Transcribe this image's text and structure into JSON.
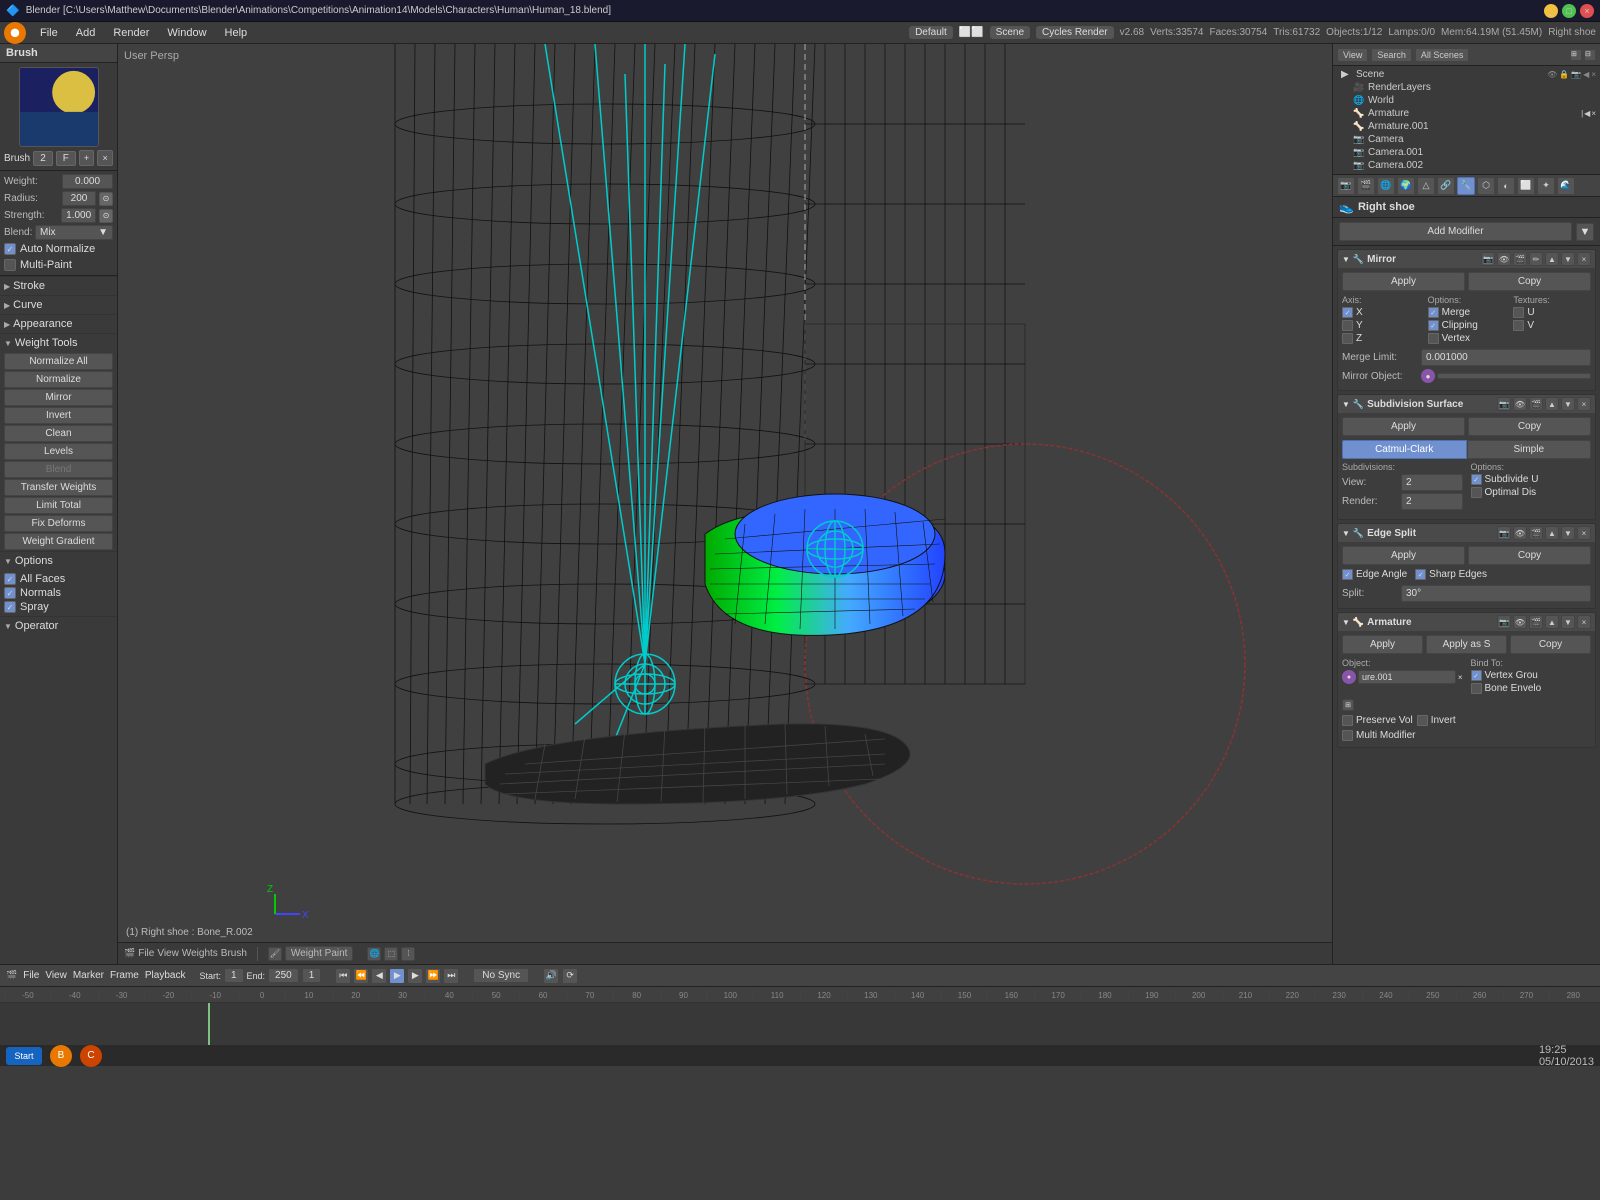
{
  "titlebar": {
    "title": "Blender  [C:\\Users\\Matthew\\Documents\\Blender\\Animations\\Competitions\\Animation14\\Models\\Characters\\Human\\Human_18.blend]"
  },
  "menubar": {
    "logo": "B",
    "items": [
      "File",
      "Add",
      "Render",
      "Window",
      "Help"
    ]
  },
  "infobar": {
    "layout": "Default",
    "scene": "Scene",
    "render": "Cycles Render",
    "version": "v2.68",
    "verts": "Verts:33574",
    "faces": "Faces:30754",
    "tris": "Tris:61732",
    "objects": "Objects:1/12",
    "lamps": "Lamps:0/0",
    "mem": "Mem:64.19M (51.45M)",
    "info": "Right shoe"
  },
  "left_panel": {
    "header": "Brush",
    "brush_num": "2",
    "brush_flag": "F",
    "weight": "0.000",
    "radius": "200",
    "strength": "1.000",
    "blend": "Mix",
    "auto_normalize": "Auto Normalize",
    "multi_paint": "Multi-Paint",
    "stroke_label": "Stroke",
    "curve_label": "Curve",
    "appearance_label": "Appearance",
    "weight_tools_label": "Weight Tools",
    "buttons": [
      "Normalize All",
      "Normalize",
      "Mirror",
      "Invert",
      "Clean",
      "Levels",
      "Blend",
      "Transfer Weights",
      "Limit Total",
      "Fix Deforms",
      "Weight Gradient"
    ],
    "options_label": "Options",
    "option_checks": [
      "All Faces",
      "Normals",
      "Spray"
    ],
    "operator_label": "Operator"
  },
  "viewport": {
    "label": "User Persp",
    "bottom_info": "(1) Right shoe : Bone_R.002"
  },
  "viewport_bottom": {
    "items": [
      "File",
      "View",
      "Weights",
      "Brush",
      "Weight Paint"
    ]
  },
  "right_panel": {
    "top_buttons": [
      "View",
      "Search",
      "All Scenes"
    ],
    "scene_tree": [
      {
        "label": "Scene",
        "depth": 0,
        "icon": "▶"
      },
      {
        "label": "RenderLayers",
        "depth": 1,
        "icon": "📷"
      },
      {
        "label": "World",
        "depth": 1,
        "icon": "🌐"
      },
      {
        "label": "Armature",
        "depth": 1,
        "icon": "🦴",
        "has_dots": true
      },
      {
        "label": "Armature.001",
        "depth": 1,
        "icon": "🦴"
      },
      {
        "label": "Camera",
        "depth": 1,
        "icon": "📷"
      },
      {
        "label": "Camera.001",
        "depth": 1,
        "icon": "📷"
      },
      {
        "label": "Camera.002",
        "depth": 1,
        "icon": "📷"
      }
    ],
    "object_name": "Right shoe",
    "add_modifier": "Add Modifier",
    "modifiers": [
      {
        "name": "Mirror",
        "axis_label": "Axis:",
        "options_label": "Options:",
        "textures_label": "Textures:",
        "axes": [
          "X",
          "Y",
          "Z"
        ],
        "options": [
          "Merge",
          "Clipping",
          "Vertex"
        ],
        "merge_limit_label": "Merge Limit:",
        "merge_limit_value": "0.001000",
        "mirror_object_label": "Mirror Object:"
      },
      {
        "name": "Subdivision Surface",
        "apply_label": "Apply",
        "copy_label": "Copy",
        "tabs": [
          "Catmul-Clark",
          "Simple"
        ],
        "subdivisions_label": "Subdivisions:",
        "options_label": "Options:",
        "view_label": "View:",
        "view_value": "2",
        "render_label": "Render:",
        "render_value": "2",
        "subdivide_u": "Subdivide U",
        "optimal_dis": "Optimal Dis"
      },
      {
        "name": "Edge Split",
        "apply_label": "Apply",
        "copy_label": "Copy",
        "edge_angle": "Edge Angle",
        "sharp_edges": "Sharp Edges",
        "split_label": "Split:",
        "split_value": "30°"
      },
      {
        "name": "Armature",
        "apply_label": "Apply",
        "apply_as_label": "Apply as S",
        "copy_label": "Copy",
        "object_label": "Object:",
        "object_value": "ure.001",
        "bind_to_label": "Bind To:",
        "vertex_group": "Vertex Grou",
        "preserve_vol": "Preserve Vol",
        "bone_envelo": "Bone Envelo",
        "invert": "Invert",
        "multi_modifier": "Multi Modifier"
      }
    ]
  },
  "timeline": {
    "start_label": "Start:",
    "start_value": "1",
    "end_label": "End:",
    "end_value": "250",
    "current": "1",
    "sync": "No Sync",
    "ruler_marks": [
      "-50",
      "-40",
      "-30",
      "-20",
      "-10",
      "0",
      "10",
      "20",
      "30",
      "40",
      "50",
      "60",
      "70",
      "80",
      "90",
      "100",
      "110",
      "120",
      "130",
      "140",
      "150",
      "160",
      "170",
      "180",
      "190",
      "200",
      "210",
      "220",
      "230",
      "240",
      "250",
      "260",
      "270",
      "280"
    ]
  },
  "statusbar": {
    "items": [
      "File",
      "View",
      "Marker",
      "Frame",
      "Playback"
    ]
  },
  "sysbar": {
    "start_label": "Start",
    "time": "19:25",
    "date": "05/10/2013"
  }
}
